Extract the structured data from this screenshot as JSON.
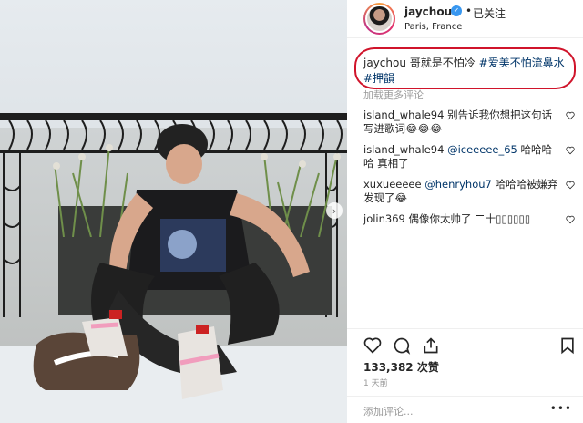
{
  "post": {
    "username": "jaychou",
    "follow_status": "已关注",
    "location": "Paris, France",
    "caption_user": "jaychou",
    "caption_text": "哥就是不怕冷",
    "caption_tags": [
      "#爱美不怕流鼻水",
      "#押韻"
    ]
  },
  "load_more": "加载更多评论",
  "comments": [
    {
      "user": "island_whale94",
      "text": "别告诉我你想把这句话写进歌词😂😂😂",
      "mention": ""
    },
    {
      "user": "island_whale94",
      "mention": "@iceeeee_65",
      "text": "哈哈哈哈 真相了"
    },
    {
      "user": "xuxueeeee",
      "mention": "@henryhou7",
      "text": "哈哈哈被嫌弃发现了😂"
    },
    {
      "user": "jolin369",
      "mention": "",
      "text": "偶像你太帅了 二十▯▯▯▯▯▯"
    }
  ],
  "likes": "133,382 次赞",
  "time_ago": "1 天前",
  "add_comment_placeholder": "添加评论...",
  "more": "•••",
  "icons": {
    "like": "heart-icon",
    "comment": "comment-icon",
    "share": "share-icon",
    "save": "bookmark-icon",
    "verified": "verified-badge-icon",
    "next": "chevron-right-icon"
  },
  "colors": {
    "link": "#003569",
    "highlight": "#d0142b",
    "verified": "#3897f0",
    "muted": "#999999"
  }
}
